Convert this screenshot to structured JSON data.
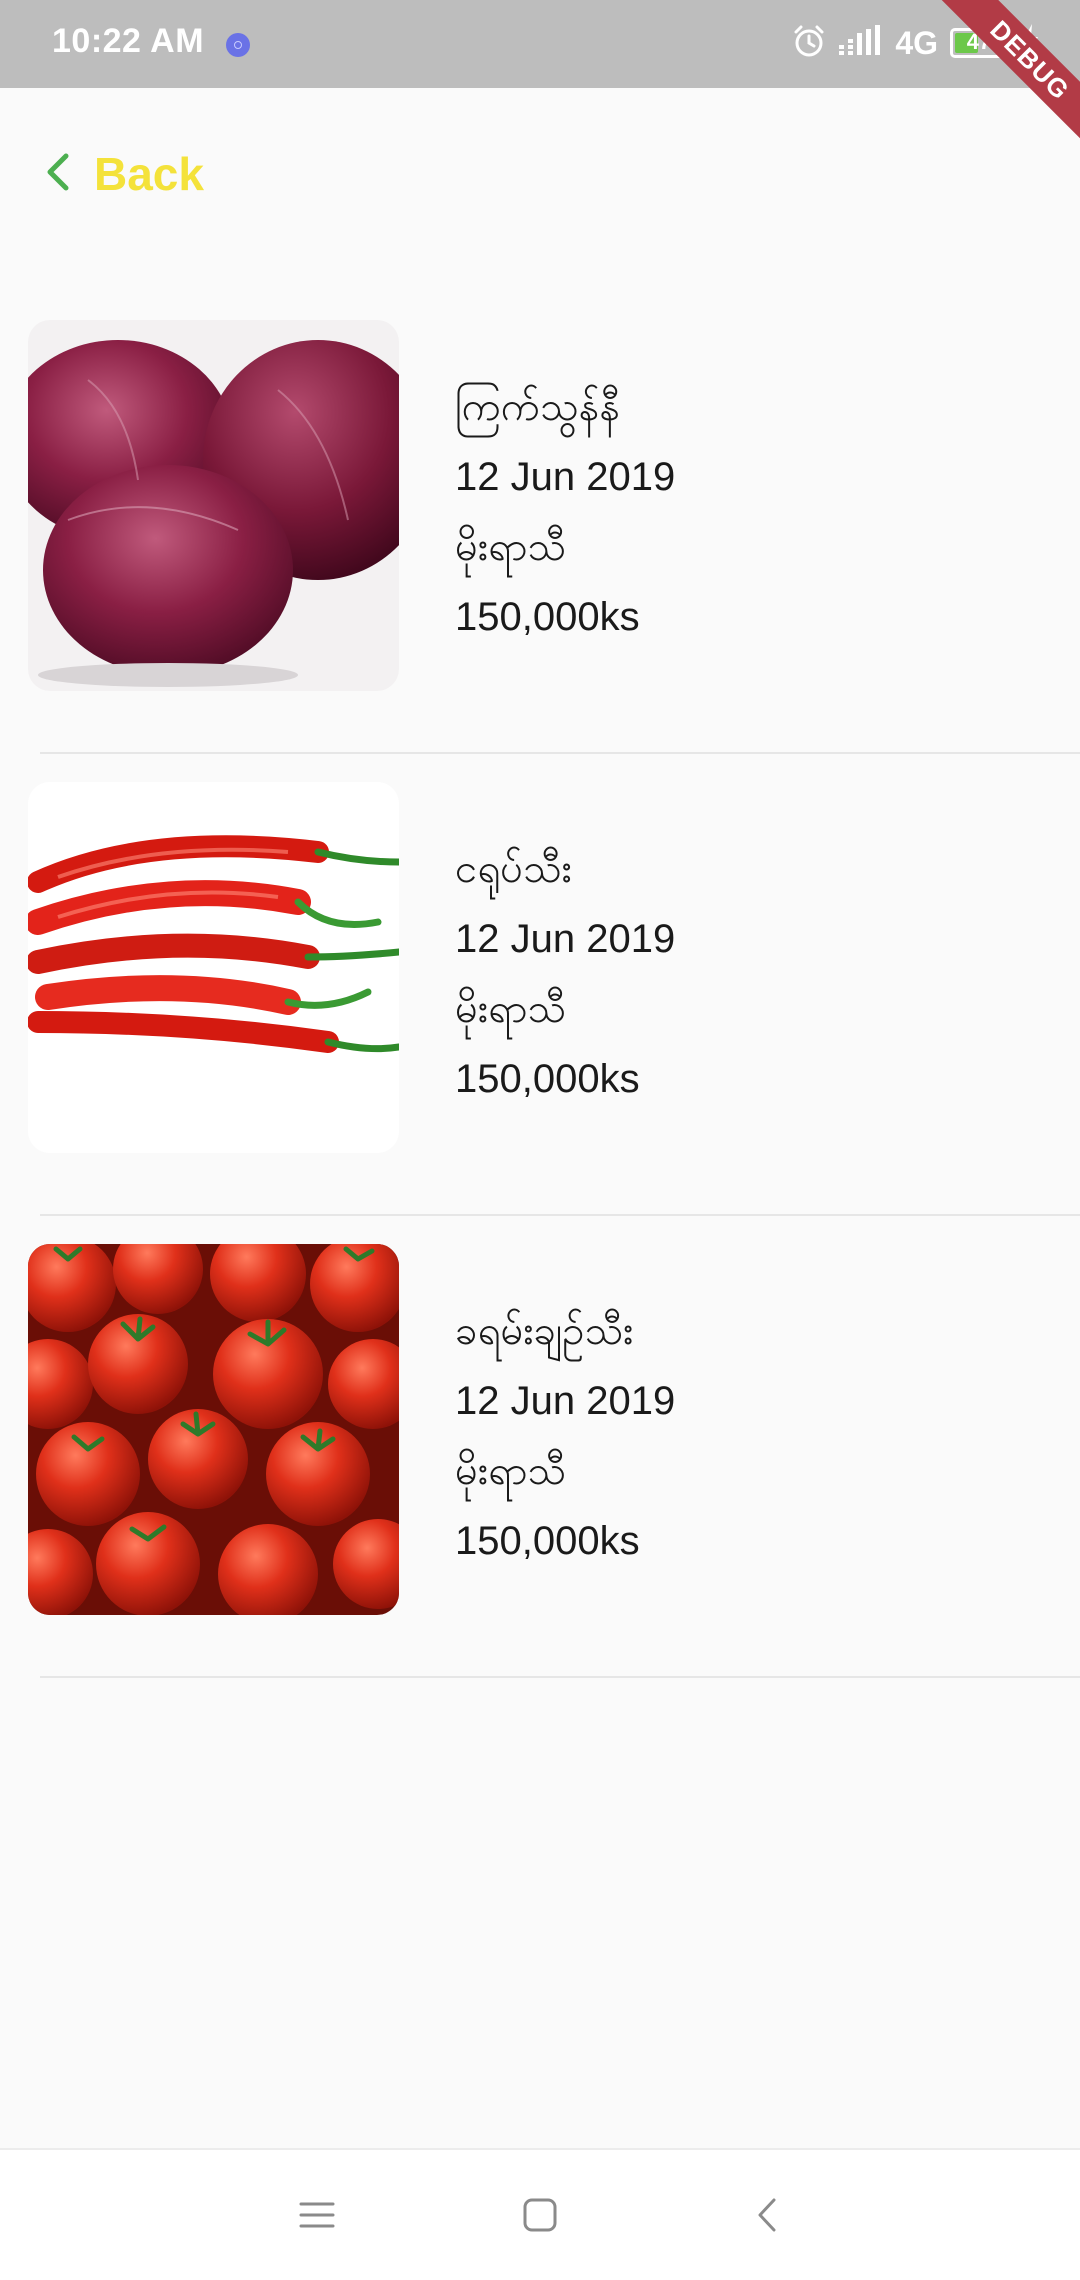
{
  "status_bar": {
    "time": "10:22 AM",
    "network": "4G",
    "battery_level": "47",
    "battery_fraction": 0.47,
    "icons": [
      "app-notification-icon",
      "alarm-icon",
      "signal-icon",
      "battery-icon",
      "charging-icon"
    ]
  },
  "debug_banner": "DEBUG",
  "header": {
    "back_label": "Back",
    "back_icon": "chevron-left-icon",
    "back_icon_color": "#4caf50",
    "back_label_color": "#f4e23a"
  },
  "products": [
    {
      "name": "ကြက်သွန်နီ",
      "date": "12 Jun 2019",
      "location": "မိုးရာသီ",
      "price": "150,000ks",
      "image": "red-onions-photo"
    },
    {
      "name": "ငရုပ်သီး",
      "date": "12 Jun 2019",
      "location": "မိုးရာသီ",
      "price": "150,000ks",
      "image": "red-chili-peppers-photo"
    },
    {
      "name": "ခရမ်းချဉ်သီး",
      "date": "12 Jun 2019",
      "location": "မိုးရာသီ",
      "price": "150,000ks",
      "image": "tomatoes-photo"
    }
  ],
  "nav_bar": {
    "icons": [
      "menu-icon",
      "home-icon",
      "back-icon"
    ]
  }
}
